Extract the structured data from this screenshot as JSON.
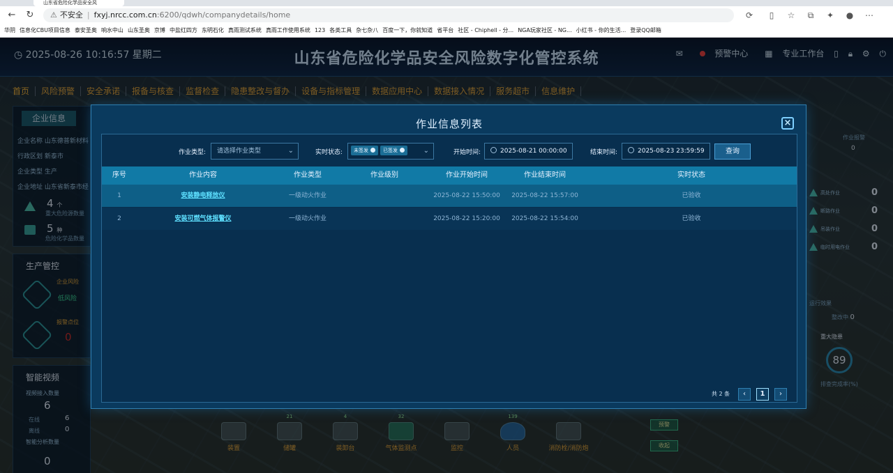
{
  "browser": {
    "tab_title": "山东省危险化学品安全风",
    "security": "不安全",
    "url_host": "fxyj.nrcc.com.cn",
    "url_path": ":6200/qdwh/companydetails/home",
    "bookmarks": [
      "华阴",
      "信息化CBU项目信息",
      "泰安圣奥",
      "响水中山",
      "山东圣奥",
      "京博",
      "中盐红四方",
      "东明石化",
      "真雨测试系统",
      "真雨工作使用系统",
      "123",
      "各类工具",
      "杂七杂八",
      "百度一下，你就知道",
      "省平台",
      "社区 - Chiphell - 分...",
      "NGA玩家社区 - NG...",
      "小红书 - 你的生活...",
      "登录QQ邮箱"
    ]
  },
  "app": {
    "datetime": "2025-08-26 10:16:57 星期二",
    "title": "山东省危险化学品安全风险数字化管控系统",
    "alert_center": "预警中心",
    "workbench": "专业工作台",
    "nav": [
      "首页",
      "风险预警",
      "安全承诺",
      "报备与核查",
      "监督检查",
      "隐患整改与督办",
      "设备与指标管理",
      "数据应用中心",
      "数据接入情况",
      "服务超市",
      "信息维护"
    ]
  },
  "left": {
    "enterprise_tab": "企业信息",
    "rows": [
      "企业名称 山东德普新材料",
      "行政区划 新泰市",
      "企业类型 生产",
      "企业地址 山东省新泰市经"
    ],
    "major_hazard_count": "4",
    "major_hazard_unit": "个",
    "major_hazard_label": "重大危险源数量",
    "chem_count": "5",
    "chem_unit": "种",
    "chem_label": "危险化学品数量",
    "production_title": "生产管控",
    "risk_label": "企业风险",
    "risk_value": "低风险",
    "alarm_label": "报警点位",
    "alarm_value": "0",
    "video_title": "智能视频",
    "video_access_label": "视频接入数量",
    "video_access_value": "6",
    "online_label": "在线",
    "online_value": "6",
    "offline_label": "离线",
    "offline_value": "0",
    "analysis_label": "智能分析数量",
    "analysis_value": "0"
  },
  "right": {
    "work_alarm_label": "作业报警",
    "work_alarm_value": "0",
    "items": [
      {
        "label": "高处作业",
        "value": "0"
      },
      {
        "label": "断路作业",
        "value": "0"
      },
      {
        "label": "吊装作业",
        "value": "0"
      },
      {
        "label": "临时用电作业",
        "value": "0"
      }
    ],
    "running_label": "运行效果",
    "rectify_label": "整改中",
    "rectify_value": "0",
    "major_hazard_title": "重大隐患",
    "ring_value": "89",
    "ring_label": "排查完成率(%)"
  },
  "bottom": {
    "items": [
      {
        "label": "装置",
        "count": ""
      },
      {
        "label": "储罐",
        "count": "21"
      },
      {
        "label": "装卸台",
        "count": "4"
      },
      {
        "label": "气体监测点",
        "count": "32"
      },
      {
        "label": "监控",
        "count": ""
      },
      {
        "label": "人员",
        "count": "139"
      },
      {
        "label": "消防栓/消防炮",
        "count": ""
      }
    ],
    "alert_btn": "预警",
    "collapse_btn": "收起"
  },
  "modal": {
    "title": "作业信息列表",
    "filter_type_label": "作业类型:",
    "filter_type_placeholder": "请选择作业类型",
    "filter_status_label": "实时状态:",
    "status_tags": [
      "未签发",
      "已签发"
    ],
    "start_label": "开始时间:",
    "start_value": "2025-08-21 00:00:00",
    "end_label": "结束时间:",
    "end_value": "2025-08-23 23:59:59",
    "query_btn": "查询",
    "columns": [
      "序号",
      "作业内容",
      "作业类型",
      "作业级别",
      "作业开始时间",
      "作业结束时间",
      "实时状态"
    ],
    "rows": [
      {
        "no": "1",
        "content": "安装静电释放仪",
        "type": "一级动火作业",
        "level": "",
        "start": "2025-08-22 15:50:00",
        "end": "2025-08-22 15:57:00",
        "status": "已验收"
      },
      {
        "no": "2",
        "content": "安装可燃气体报警仪",
        "type": "一级动火作业",
        "level": "",
        "start": "2025-08-22 15:20:00",
        "end": "2025-08-22 15:54:00",
        "status": "已验收"
      }
    ],
    "total_text": "共 2 条",
    "current_page": "1"
  }
}
